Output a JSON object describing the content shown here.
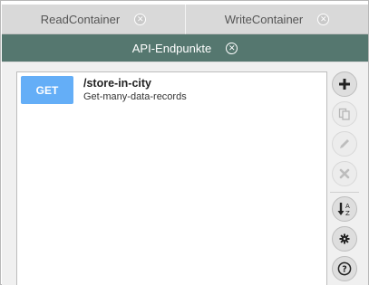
{
  "tabs": {
    "top": [
      {
        "label": "ReadContainer",
        "close_icon": "close-circle-icon"
      },
      {
        "label": "WriteContainer",
        "close_icon": "close-circle-icon"
      }
    ],
    "active": {
      "label": "API-Endpunkte",
      "close_icon": "close-circle-icon"
    }
  },
  "endpoints": [
    {
      "method": "GET",
      "path": "/store-in-city",
      "description": "Get-many-data-records"
    }
  ],
  "toolbar": {
    "buttons": [
      {
        "icon": "plus-icon",
        "enabled": true
      },
      {
        "icon": "copy-icon",
        "enabled": false
      },
      {
        "icon": "pencil-icon",
        "enabled": false
      },
      {
        "icon": "delete-x-icon",
        "enabled": false
      },
      {
        "icon": "sort-az-icon",
        "enabled": true
      },
      {
        "icon": "gear-icon",
        "enabled": true
      },
      {
        "icon": "help-icon",
        "enabled": true
      }
    ]
  },
  "colors": {
    "active_tab": "#55776f",
    "inactive_tab": "#d9d9d9",
    "method_get": "#64aef7"
  }
}
